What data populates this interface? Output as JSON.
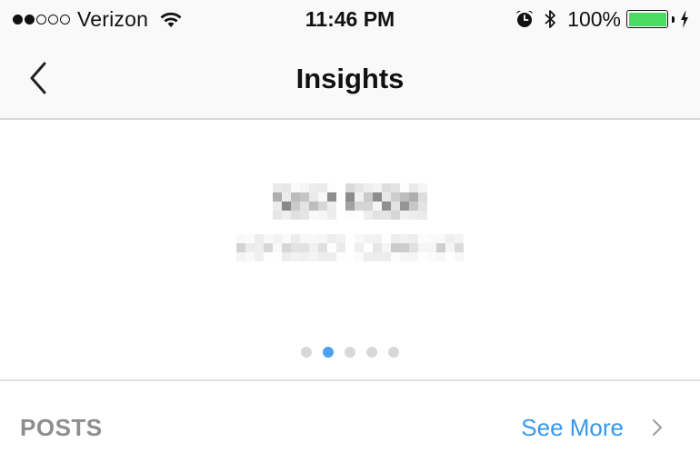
{
  "status_bar": {
    "signal_bars_filled": 2,
    "signal_bars_total": 5,
    "carrier": "Verizon",
    "time": "11:46 PM",
    "battery_percent": "100%",
    "battery_level": 1.0,
    "icons": [
      "signal-dots-icon",
      "wifi-icon",
      "alarm-icon",
      "bluetooth-icon",
      "battery-icon",
      "charging-bolt-icon"
    ],
    "colors": {
      "battery_fill": "#4cd964"
    }
  },
  "nav": {
    "title": "Insights",
    "back_icon": "chevron-left-icon"
  },
  "carousel": {
    "headline_redacted": true,
    "subline_redacted": true,
    "page_count": 5,
    "active_page": 2,
    "colors": {
      "active_dot": "#4aa3f0",
      "inactive_dot": "#d8d8d8"
    }
  },
  "posts_section": {
    "label": "POSTS",
    "see_more_label": "See More",
    "chevron_icon": "chevron-right-icon",
    "colors": {
      "link": "#3897f0",
      "label": "#8e8e8e"
    }
  }
}
